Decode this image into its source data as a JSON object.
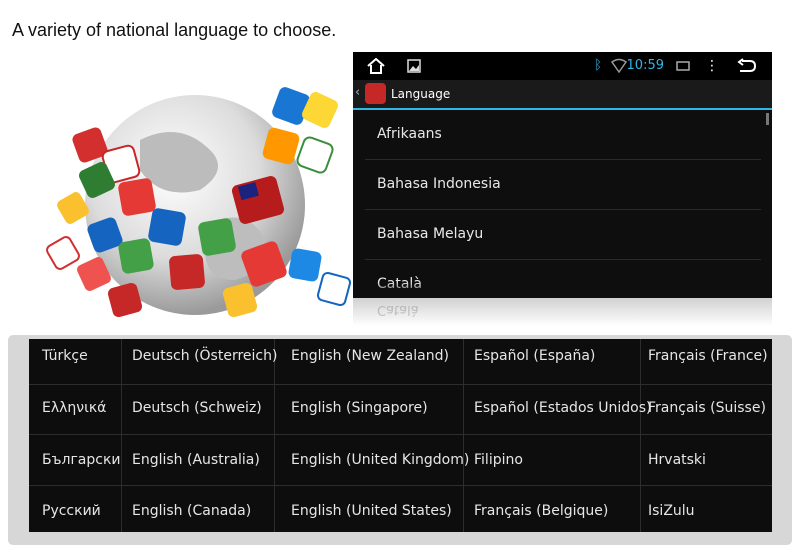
{
  "headline": "A variety of national language to choose.",
  "status_bar": {
    "time": "10:59",
    "icons": [
      "home-icon",
      "gallery-icon",
      "bluetooth-icon",
      "wifi-icon",
      "screenshot-icon",
      "overflow-menu-icon",
      "back-icon"
    ]
  },
  "action_bar": {
    "title": "Language"
  },
  "language_list": [
    "Afrikaans",
    "Bahasa Indonesia",
    "Bahasa Melayu",
    "Català"
  ],
  "reflection_text": "Català",
  "language_table": {
    "rows": [
      [
        "Türkçe",
        "Deutsch (Österreich)",
        "English (New Zealand)",
        "Español (España)",
        "Français (France)"
      ],
      [
        "Ελληνικά",
        "Deutsch (Schweiz)",
        "English (Singapore)",
        "Español (Estados Unidos)",
        "Français (Suisse)"
      ],
      [
        "Български",
        "English (Australia)",
        "English (United Kingdom)",
        "Filipino",
        "Hrvatski"
      ],
      [
        "Русский",
        "English (Canada)",
        "English (United States)",
        "Français (Belgique)",
        "IsiZulu"
      ]
    ]
  },
  "colors": {
    "accent": "#33b5e5",
    "panel_bg": "#0e0e0e",
    "table_bg": "#0d0d0d",
    "frame": "#d7d7d7"
  }
}
